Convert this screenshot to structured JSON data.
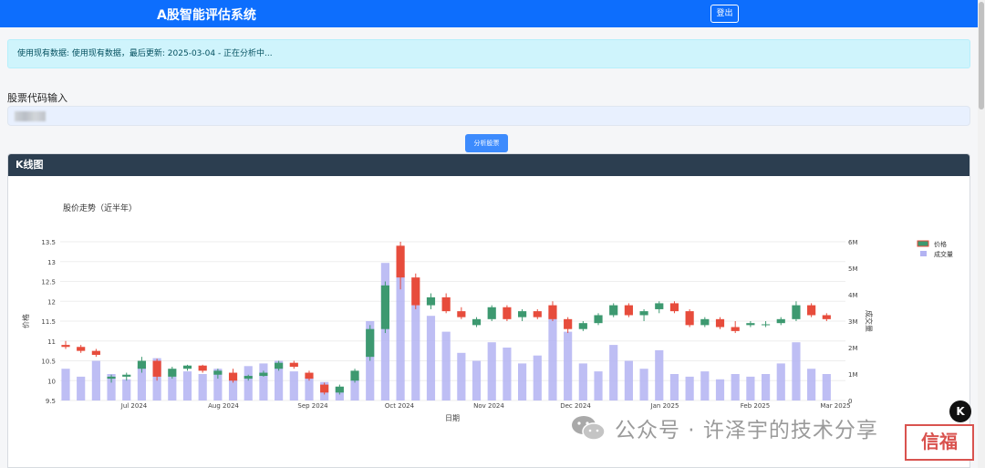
{
  "navbar": {
    "brand": "A股智能评估系统",
    "logout_label": "登出"
  },
  "alert": {
    "message": "使用现有数据: 使用现有数据，最后更新: 2025-03-04 - 正在分析中..."
  },
  "stock_input": {
    "label": "股票代码输入",
    "value": ""
  },
  "analyze_button": {
    "label": "分析股票"
  },
  "card": {
    "title": "K线图"
  },
  "chart_data": {
    "type": "candlestick",
    "title": "股价走势（近半年）",
    "xlabel": "日期",
    "ylabel": "价格",
    "y2label": "成交量",
    "ylim": [
      9.5,
      13.5
    ],
    "y2lim": [
      0,
      6000000
    ],
    "yticks": [
      "9.5",
      "10",
      "10.5",
      "11",
      "11.5",
      "12",
      "12.5",
      "13",
      "13.5"
    ],
    "y2ticks": [
      "0",
      "1M",
      "2M",
      "3M",
      "4M",
      "5M",
      "6M"
    ],
    "xticks": [
      "Jul 2024",
      "Aug 2024",
      "Sep 2024",
      "Oct 2024",
      "Nov 2024",
      "Dec 2024",
      "Jan 2025",
      "Feb 2025",
      "Mar 2025"
    ],
    "legend": [
      "价格",
      "成交量"
    ],
    "legend_position": "top-right",
    "colors": {
      "up": "#3d9970",
      "down": "#e74c3c",
      "volume": "#b3b3f2"
    },
    "series": [
      {
        "name": "价格",
        "values": [
          [
            10.9,
            11.0,
            10.8,
            10.85
          ],
          [
            10.85,
            10.9,
            10.7,
            10.75
          ],
          [
            10.75,
            10.8,
            10.6,
            10.65
          ],
          [
            10.05,
            10.15,
            9.95,
            10.1
          ],
          [
            10.1,
            10.2,
            10.0,
            10.15
          ],
          [
            10.3,
            10.6,
            10.2,
            10.5
          ],
          [
            10.5,
            10.55,
            10.0,
            10.1
          ],
          [
            10.1,
            10.35,
            10.05,
            10.3
          ],
          [
            10.3,
            10.4,
            10.25,
            10.38
          ],
          [
            10.38,
            10.4,
            10.2,
            10.25
          ],
          [
            10.15,
            10.3,
            10.05,
            10.25
          ],
          [
            10.2,
            10.3,
            9.95,
            10.0
          ],
          [
            10.05,
            10.15,
            10.0,
            10.12
          ],
          [
            10.12,
            10.25,
            10.1,
            10.2
          ],
          [
            10.3,
            10.5,
            10.25,
            10.45
          ],
          [
            10.45,
            10.5,
            10.3,
            10.35
          ],
          [
            10.2,
            10.25,
            10.0,
            10.05
          ],
          [
            9.9,
            9.95,
            9.65,
            9.7
          ],
          [
            9.7,
            9.9,
            9.65,
            9.85
          ],
          [
            10.0,
            10.3,
            9.95,
            10.25
          ],
          [
            10.6,
            11.4,
            10.5,
            11.3
          ],
          [
            11.3,
            12.5,
            11.2,
            12.4
          ],
          [
            13.4,
            13.5,
            12.3,
            12.6
          ],
          [
            12.6,
            12.7,
            11.8,
            11.9
          ],
          [
            11.9,
            12.2,
            11.8,
            12.1
          ],
          [
            12.1,
            12.2,
            11.7,
            11.75
          ],
          [
            11.75,
            11.85,
            11.55,
            11.6
          ],
          [
            11.4,
            11.6,
            11.35,
            11.55
          ],
          [
            11.55,
            11.9,
            11.5,
            11.85
          ],
          [
            11.85,
            11.9,
            11.5,
            11.55
          ],
          [
            11.6,
            11.8,
            11.5,
            11.75
          ],
          [
            11.75,
            11.8,
            11.55,
            11.6
          ],
          [
            11.9,
            12.0,
            11.5,
            11.55
          ],
          [
            11.55,
            11.6,
            11.2,
            11.3
          ],
          [
            11.3,
            11.5,
            11.25,
            11.45
          ],
          [
            11.45,
            11.7,
            11.4,
            11.65
          ],
          [
            11.65,
            11.95,
            11.6,
            11.9
          ],
          [
            11.9,
            11.95,
            11.6,
            11.65
          ],
          [
            11.65,
            11.8,
            11.5,
            11.75
          ],
          [
            11.8,
            12.0,
            11.7,
            11.95
          ],
          [
            11.95,
            12.0,
            11.7,
            11.75
          ],
          [
            11.75,
            11.8,
            11.35,
            11.4
          ],
          [
            11.4,
            11.6,
            11.35,
            11.55
          ],
          [
            11.55,
            11.6,
            11.3,
            11.35
          ],
          [
            11.35,
            11.5,
            11.2,
            11.25
          ],
          [
            11.4,
            11.5,
            11.35,
            11.45
          ],
          [
            11.4,
            11.5,
            11.35,
            11.42
          ],
          [
            11.45,
            11.6,
            11.4,
            11.55
          ],
          [
            11.55,
            12.0,
            11.5,
            11.9
          ],
          [
            11.9,
            11.95,
            11.6,
            11.65
          ],
          [
            11.65,
            11.7,
            11.5,
            11.55
          ]
        ]
      },
      {
        "name": "成交量",
        "values": [
          1200000,
          900000,
          1500000,
          1000000,
          800000,
          1300000,
          1600000,
          900000,
          1100000,
          1000000,
          1200000,
          800000,
          1300000,
          1400000,
          1500000,
          1100000,
          900000,
          700000,
          500000,
          900000,
          3000000,
          5200000,
          4800000,
          3600000,
          3200000,
          2600000,
          1800000,
          1500000,
          2200000,
          2000000,
          1400000,
          1700000,
          3300000,
          2600000,
          1400000,
          1100000,
          2100000,
          1500000,
          1200000,
          1900000,
          1000000,
          900000,
          1100000,
          800000,
          1000000,
          900000,
          1000000,
          1400000,
          2200000,
          1200000,
          1000000
        ]
      }
    ]
  },
  "floating_button": {
    "label": "K"
  },
  "watermark": {
    "text": "公众号 · 许泽宇的技术分享",
    "stamp": "信福"
  }
}
